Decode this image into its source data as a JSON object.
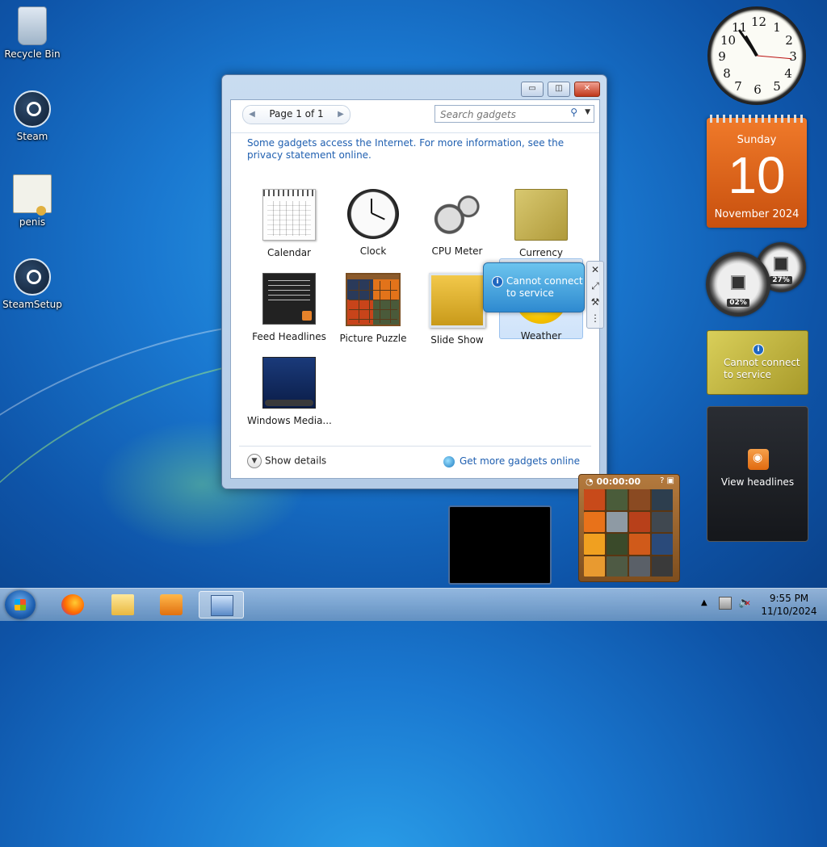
{
  "desktop": {
    "icons": [
      {
        "label": "Recycle Bin"
      },
      {
        "label": "Steam"
      },
      {
        "label": "penis"
      },
      {
        "label": "SteamSetup"
      }
    ]
  },
  "gallery": {
    "pager_label": "Page 1 of 1",
    "search_placeholder": "Search gadgets",
    "notice": "Some gadgets access the Internet.  For more information, see the privacy statement online.",
    "gadgets": [
      {
        "label": "Calendar",
        "icon": "calendar-icon"
      },
      {
        "label": "Clock",
        "icon": "clock-icon"
      },
      {
        "label": "CPU Meter",
        "icon": "cpu-meter-icon"
      },
      {
        "label": "Currency",
        "icon": "currency-icon"
      },
      {
        "label": "Feed Headlines",
        "icon": "feed-icon"
      },
      {
        "label": "Picture Puzzle",
        "icon": "puzzle-icon"
      },
      {
        "label": "Slide Show",
        "icon": "slideshow-icon"
      },
      {
        "label": "Weather",
        "icon": "weather-icon",
        "selected": true
      },
      {
        "label": "Windows Media...",
        "icon": "media-center-icon"
      }
    ],
    "show_details": "Show details",
    "get_more": "Get more gadgets online"
  },
  "floating_weather": {
    "message": "Cannot connect to service"
  },
  "sidebar_gadgets": {
    "clock_numbers": [
      "12",
      "1",
      "2",
      "3",
      "4",
      "5",
      "6",
      "7",
      "8",
      "9",
      "10",
      "11"
    ],
    "calendar": {
      "weekday": "Sunday",
      "day": "10",
      "month_year": "November 2024"
    },
    "cpu": {
      "cpu_percent": "02%",
      "memory_percent": "27%"
    },
    "currency_message": "Cannot connect to service",
    "feed_label": "View headlines",
    "puzzle_time": "00:00:00"
  },
  "taskbar": {
    "time": "9:55 PM",
    "date": "11/10/2024"
  },
  "colors": {
    "accent_link": "#1f5fb0",
    "calendar_orange": "#f07a2a",
    "close_red": "#c0381c"
  }
}
